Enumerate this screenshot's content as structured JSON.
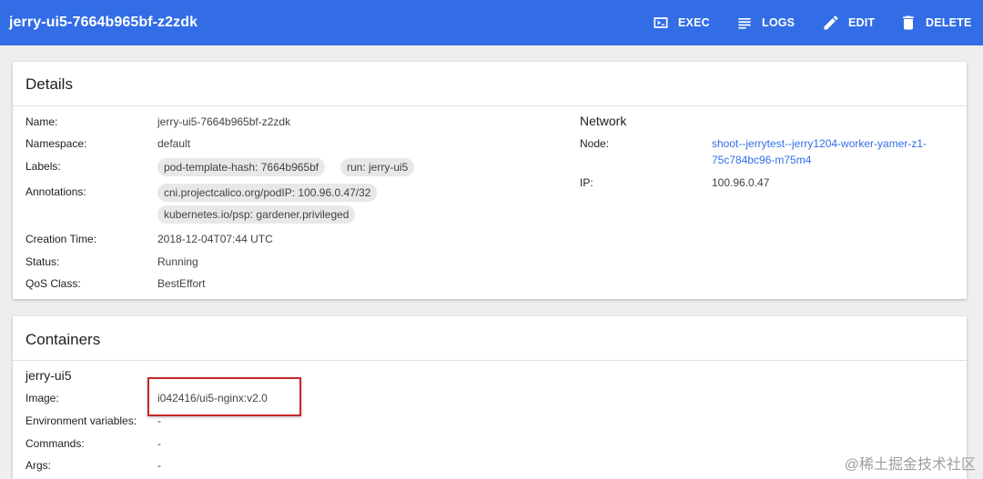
{
  "header": {
    "title": "jerry-ui5-7664b965bf-z2zdk",
    "actions": [
      {
        "label": "EXEC",
        "icon": "exec-icon"
      },
      {
        "label": "LOGS",
        "icon": "logs-icon"
      },
      {
        "label": "EDIT",
        "icon": "pencil-icon"
      },
      {
        "label": "DELETE",
        "icon": "trash-icon"
      }
    ]
  },
  "details": {
    "title": "Details",
    "name_label": "Name:",
    "name": "jerry-ui5-7664b965bf-z2zdk",
    "namespace_label": "Namespace:",
    "namespace": "default",
    "labels_label": "Labels:",
    "labels": [
      "pod-template-hash: 7664b965bf",
      "run: jerry-ui5"
    ],
    "annotations_label": "Annotations:",
    "annotations": [
      "cni.projectcalico.org/podIP:  100.96.0.47/32",
      "kubernetes.io/psp:  gardener.privileged"
    ],
    "creation_label": "Creation Time:",
    "creation": "2018-12-04T07:44 UTC",
    "status_label": "Status:",
    "status": "Running",
    "qos_label": "QoS Class:",
    "qos": "BestEffort",
    "network": {
      "title": "Network",
      "node_label": "Node:",
      "node": "shoot--jerrytest--jerry1204-worker-yamer-z1-75c784bc96-m75m4",
      "ip_label": "IP:",
      "ip": "100.96.0.47"
    }
  },
  "containers": {
    "title": "Containers",
    "name": "jerry-ui5",
    "image_label": "Image:",
    "image": "i042416/ui5-nginx:v2.0",
    "env_label": "Environment variables:",
    "env": "-",
    "commands_label": "Commands:",
    "commands": "-",
    "args_label": "Args:",
    "args": "-"
  },
  "watermark": "@稀土掘金技术社区",
  "colors": {
    "primary": "#326de6",
    "highlight": "#c62828"
  }
}
